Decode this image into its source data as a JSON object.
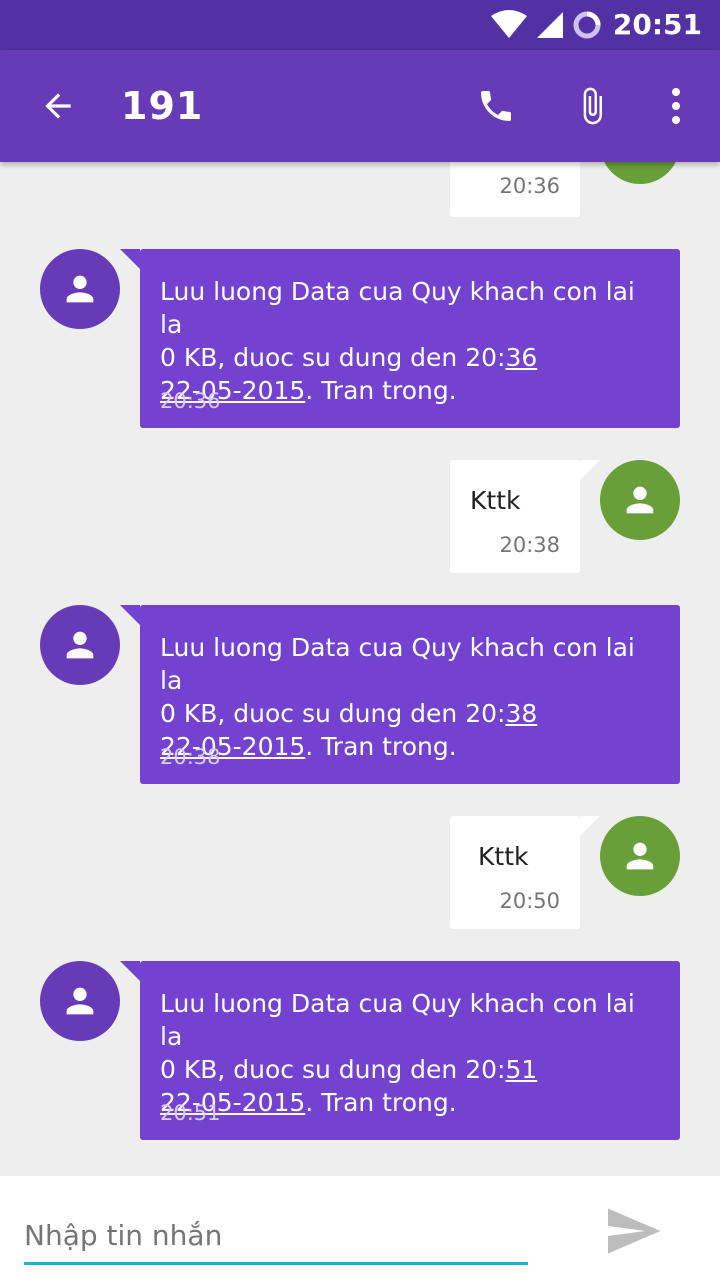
{
  "status_bar": {
    "time": "20:51"
  },
  "app_bar": {
    "title": "191"
  },
  "messages": [
    {
      "direction": "out",
      "time": "20:36"
    },
    {
      "direction": "in",
      "line1": "Luu luong Data cua Quy khach con lai la",
      "line2_prefix": "0 KB, duoc su dung den 20:",
      "line2_link": "36",
      "line3_link": "22-05-2015",
      "line3_suffix": ". Tran trong.",
      "time": "20:36"
    },
    {
      "direction": "out",
      "text": "Kttk",
      "time": "20:38"
    },
    {
      "direction": "in",
      "line1": "Luu luong Data cua Quy khach con lai la",
      "line2_prefix": "0 KB, duoc su dung den 20:",
      "line2_link": "38",
      "line3_link": "22-05-2015",
      "line3_suffix": ". Tran trong.",
      "time": "20:38"
    },
    {
      "direction": "out",
      "text": "Kttk",
      "time": "20:50"
    },
    {
      "direction": "in",
      "line1": "Luu luong Data cua Quy khach con lai la",
      "line2_prefix": "0 KB, duoc su dung den 20:",
      "line2_link": "51",
      "line3_link": "22-05-2015",
      "line3_suffix": ". Tran trong.",
      "time": "20:51"
    }
  ],
  "composer": {
    "placeholder": "Nhập tin nhắn"
  },
  "colors": {
    "status_bar": "#5231a5",
    "app_bar": "#673ab7",
    "incoming_bubble": "#7342d1",
    "contact_avatar": "#673ab7",
    "self_avatar": "#689f38",
    "input_underline": "#1ab5c9"
  }
}
